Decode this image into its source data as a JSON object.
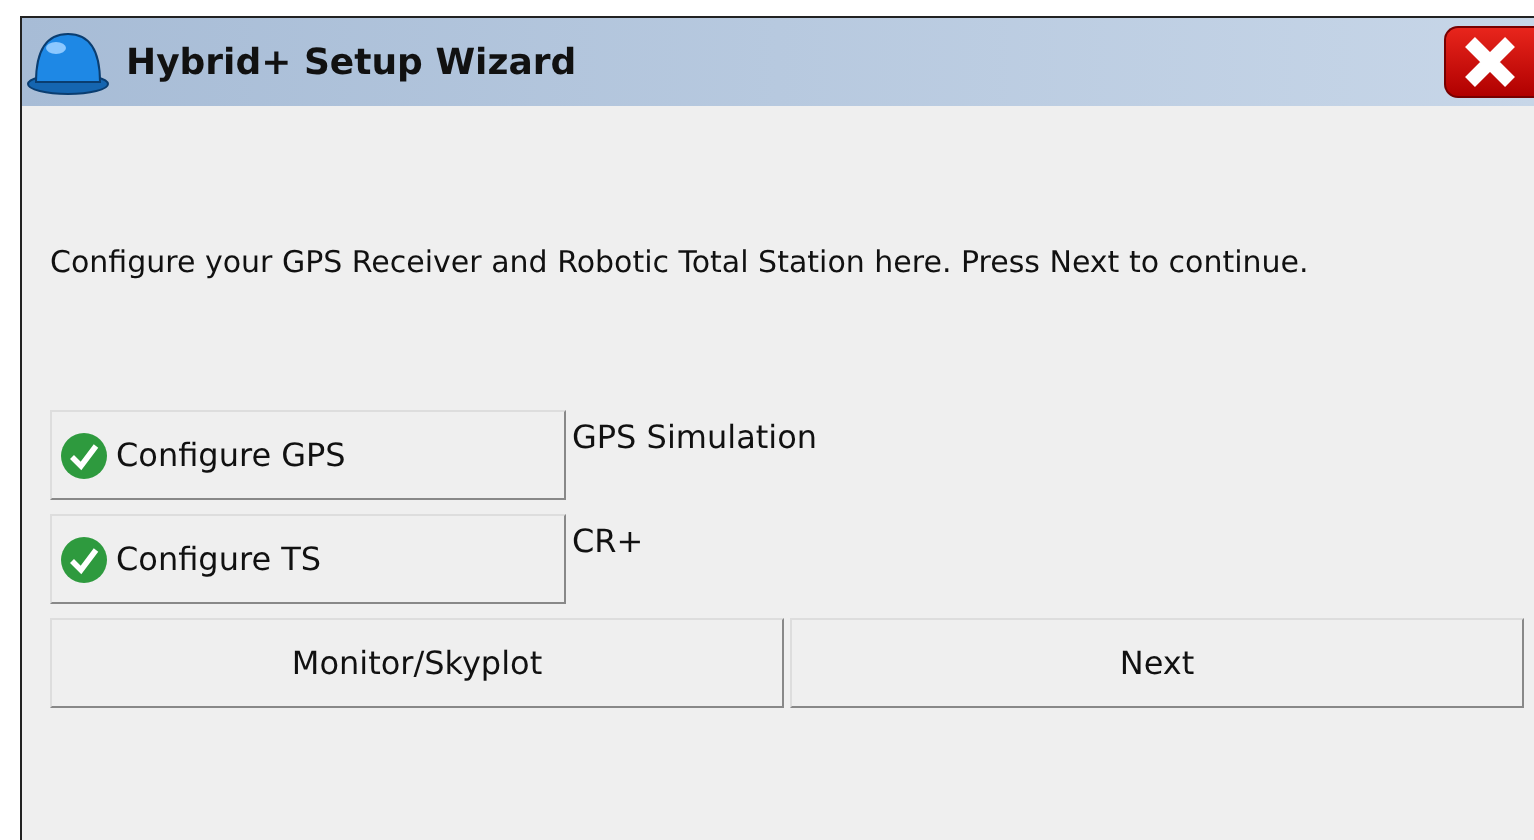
{
  "window": {
    "title": "Hybrid+ Setup Wizard"
  },
  "instructions": "Configure your GPS Receiver and Robotic Total Station here. Press Next to continue.",
  "devices": [
    {
      "label": "Configure GPS",
      "configured": true,
      "status": "GPS Simulation"
    },
    {
      "label": "Configure TS",
      "configured": true,
      "status": "CR+"
    }
  ],
  "buttons": [
    "Monitor/Skyplot",
    "Next"
  ]
}
